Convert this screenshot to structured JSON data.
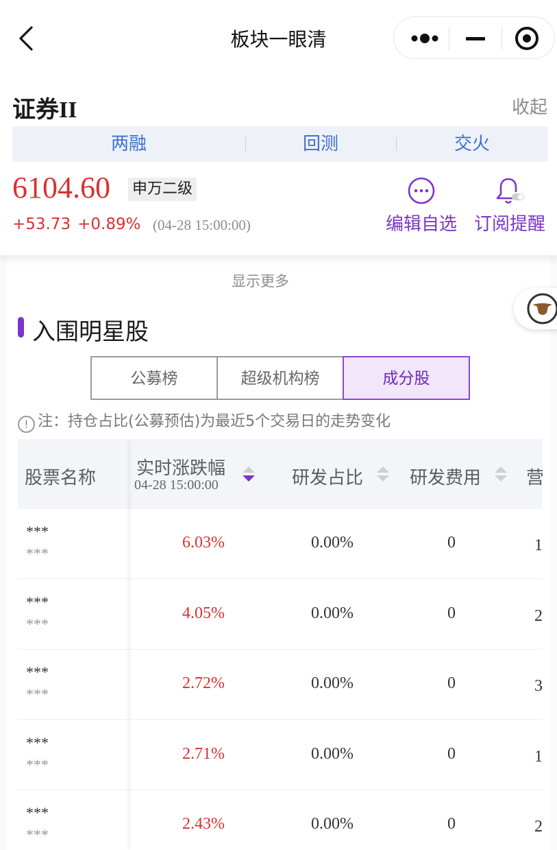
{
  "nav": {
    "title": "板块一眼清"
  },
  "sector": {
    "name": "证券II",
    "collapse_label": "收起",
    "quick_tabs": [
      "两融",
      "回测",
      "交火"
    ],
    "price": "6104.60",
    "level_badge": "申万二级",
    "change_abs": "+53.73",
    "change_pct": "+0.89%",
    "change_time": "(04-28 15:00:00)",
    "actions": [
      {
        "label": "编辑自选",
        "icon": "more-circle-icon"
      },
      {
        "label": "订阅提醒",
        "icon": "bell-toggle-icon"
      }
    ]
  },
  "main": {
    "show_more": "显示更多",
    "section_title": "入围明星股",
    "segments": [
      "公募榜",
      "超级机构榜",
      "成分股"
    ],
    "active_segment": "成分股",
    "note": "注：持仓占比(公募预估)为最近5个交易日的走势变化"
  },
  "table": {
    "headers": {
      "name": "股票名称",
      "change": "实时涨跌幅",
      "change_time": "04-28 15:00:00",
      "rd_ratio": "研发占比",
      "rd_cost": "研发费用",
      "revenue": "营"
    },
    "rows": [
      {
        "name": "***",
        "code": "***",
        "change": "6.03%",
        "rd_ratio": "0.00%",
        "rd_cost": "0",
        "revenue": "1"
      },
      {
        "name": "***",
        "code": "***",
        "change": "4.05%",
        "rd_ratio": "0.00%",
        "rd_cost": "0",
        "revenue": "2"
      },
      {
        "name": "***",
        "code": "***",
        "change": "2.72%",
        "rd_ratio": "0.00%",
        "rd_cost": "0",
        "revenue": "3"
      },
      {
        "name": "***",
        "code": "***",
        "change": "2.71%",
        "rd_ratio": "0.00%",
        "rd_cost": "0",
        "revenue": "1"
      },
      {
        "name": "***",
        "code": "***",
        "change": "2.43%",
        "rd_ratio": "0.00%",
        "rd_cost": "0",
        "revenue": "2"
      }
    ]
  },
  "colors": {
    "up_red": "#d93131",
    "accent_purple": "#7b35c9",
    "link_blue": "#3f6fd1"
  }
}
